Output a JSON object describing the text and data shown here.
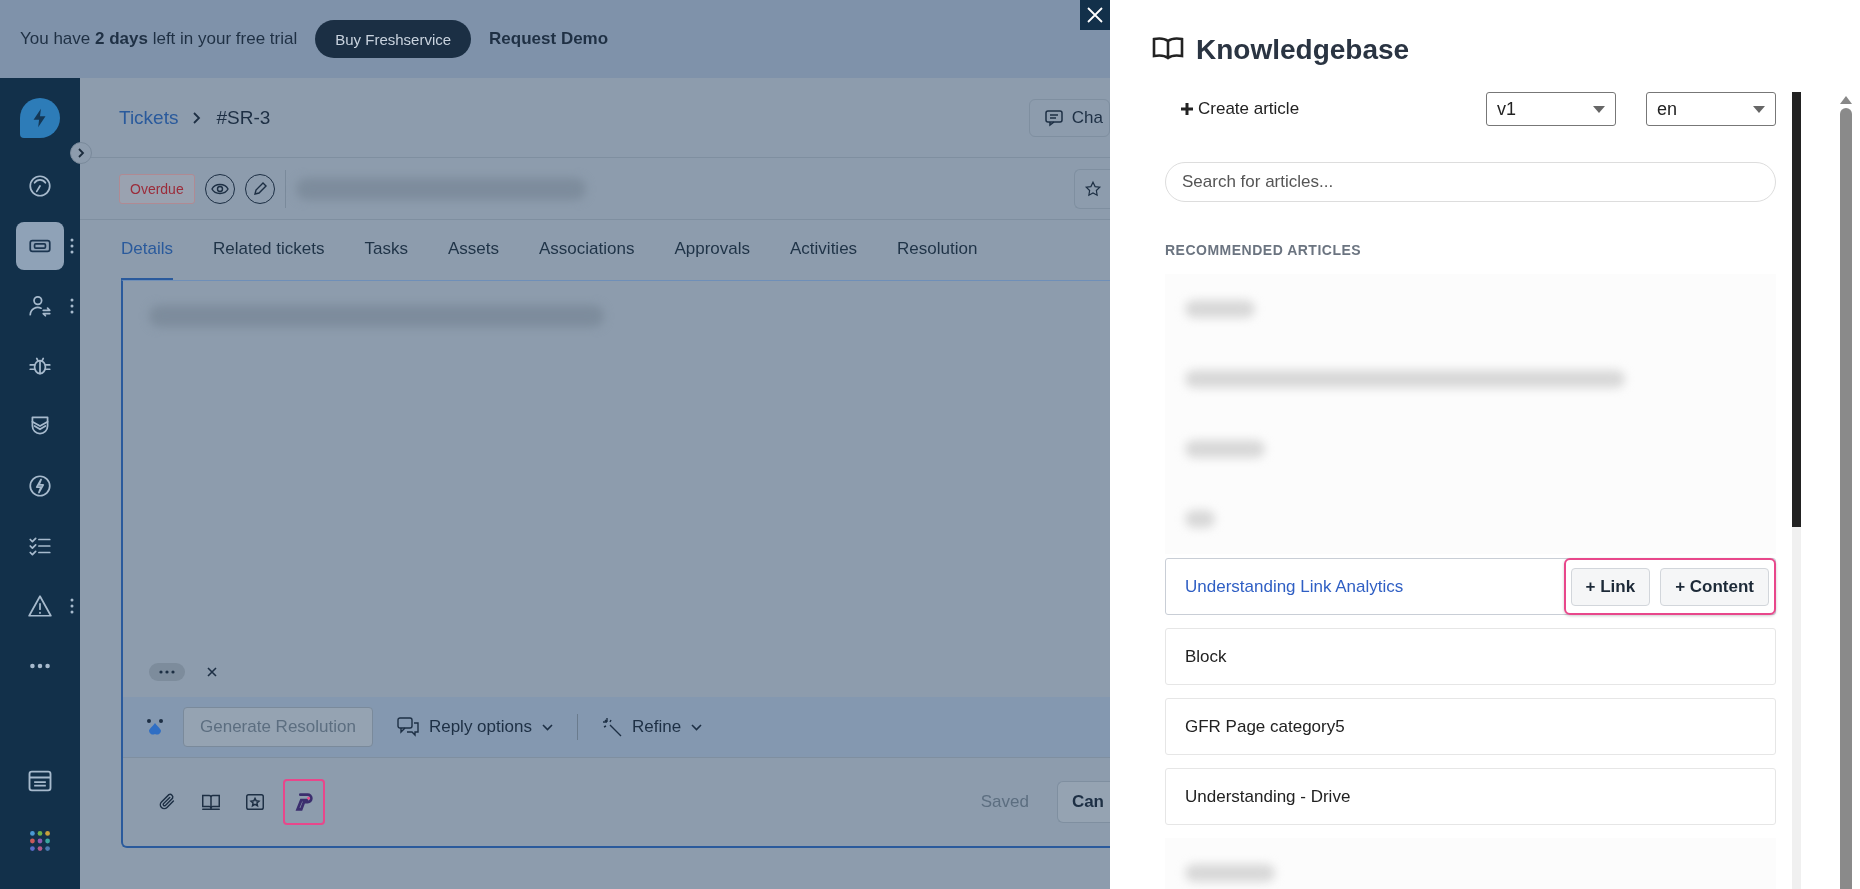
{
  "trial_banner": {
    "message": "You have **2 days** left in your free trial",
    "buy_button": "Buy Freshservice",
    "demo_link": "Request Demo"
  },
  "sidebar": {
    "items": [
      {
        "kind": "dashboard",
        "selected": false,
        "has_menu": false
      },
      {
        "kind": "tickets",
        "selected": true,
        "has_menu": true
      },
      {
        "kind": "people",
        "selected": false,
        "has_menu": true
      },
      {
        "kind": "bug",
        "selected": false,
        "has_menu": false
      },
      {
        "kind": "shield",
        "selected": false,
        "has_menu": false
      },
      {
        "kind": "bolt",
        "selected": false,
        "has_menu": false
      },
      {
        "kind": "checklist",
        "selected": false,
        "has_menu": false
      },
      {
        "kind": "warning",
        "selected": false,
        "has_menu": true
      },
      {
        "kind": "more",
        "selected": false,
        "has_menu": false
      }
    ],
    "bottom_items": [
      {
        "kind": "window"
      },
      {
        "kind": "apps"
      }
    ]
  },
  "breadcrumb": {
    "parent": "Tickets",
    "current": "#SR-3"
  },
  "header": {
    "status_badge": "Overdue",
    "chat_button": "Cha"
  },
  "tabs": [
    {
      "label": "Details",
      "selected": true
    },
    {
      "label": "Related tickets",
      "selected": false
    },
    {
      "label": "Tasks",
      "selected": false
    },
    {
      "label": "Assets",
      "selected": false
    },
    {
      "label": "Associations",
      "selected": false
    },
    {
      "label": "Approvals",
      "selected": false
    },
    {
      "label": "Activities",
      "selected": false
    },
    {
      "label": "Resolution",
      "selected": false
    }
  ],
  "editor": {
    "generate_button": "Generate Resolution",
    "generate_disabled": true,
    "reply_options": "Reply options",
    "refine": "Refine",
    "tools": [
      {
        "kind": "attach",
        "highlighted": false
      },
      {
        "kind": "book",
        "highlighted": false
      },
      {
        "kind": "canned",
        "highlighted": false
      },
      {
        "kind": "app",
        "highlighted": true
      }
    ],
    "status": "Saved",
    "cancel_button": "Can"
  },
  "knowledgebase": {
    "title": "Knowledgebase",
    "create_article": "Create article",
    "version": "v1",
    "language": "en",
    "search": {
      "placeholder": "Search for articles..."
    },
    "section_label": "RECOMMENDED ARTICLES",
    "articles": [
      {
        "kind": "redacted"
      },
      {
        "kind": "redacted"
      },
      {
        "kind": "redacted"
      },
      {
        "kind": "redacted"
      },
      {
        "kind": "article",
        "title": "Understanding Link Analytics",
        "selected": true
      },
      {
        "kind": "article",
        "title": "Block",
        "selected": false
      },
      {
        "kind": "article",
        "title": "GFR Page category5",
        "selected": false
      },
      {
        "kind": "article",
        "title": "Understanding - Drive",
        "selected": false
      },
      {
        "kind": "redacted"
      }
    ],
    "actions_highlighted": true,
    "link_button": "+ Link",
    "content_button": "+ Content"
  }
}
